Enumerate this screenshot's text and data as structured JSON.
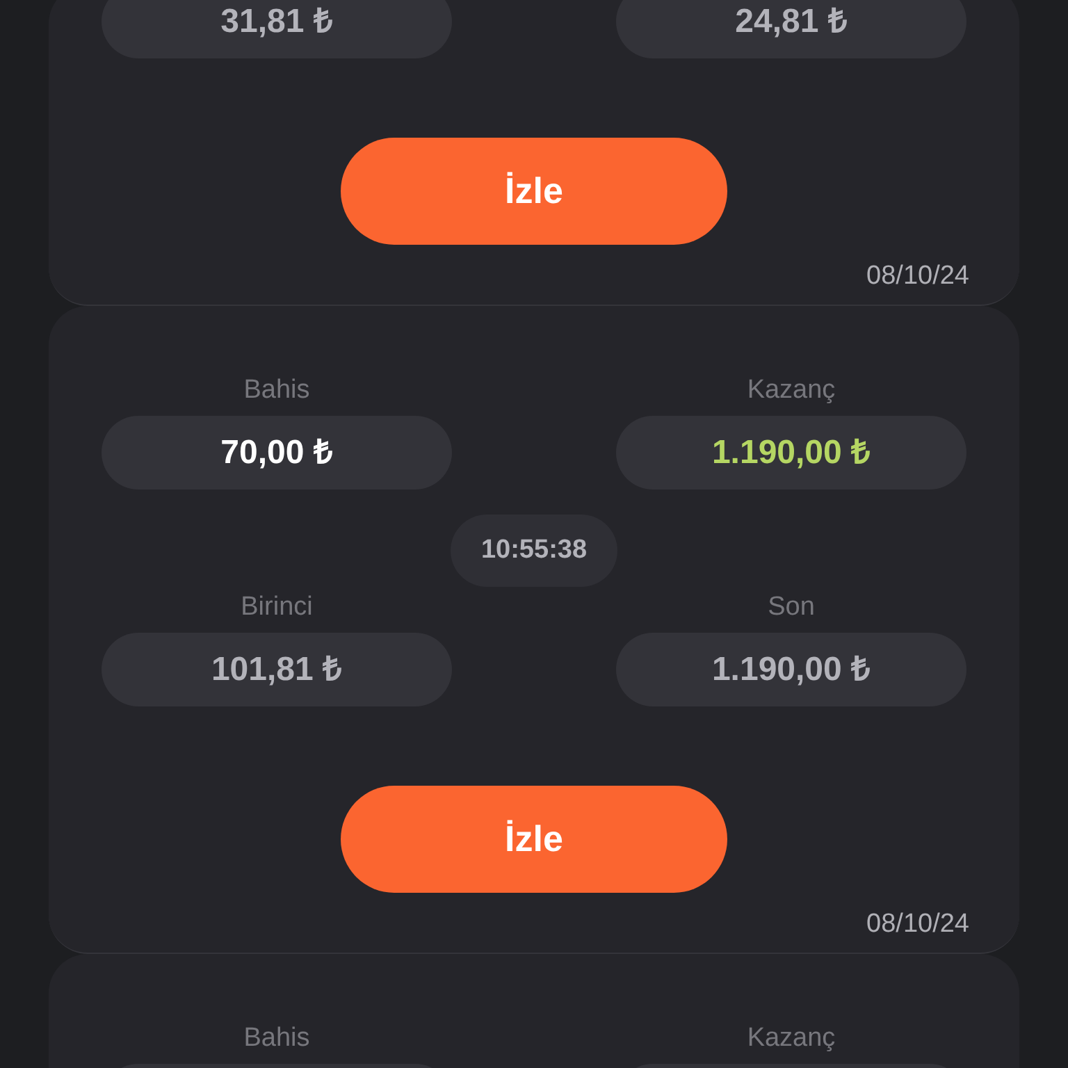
{
  "bets": [
    {
      "rows": [
        [
          {
            "value": "31,81 ₺",
            "kind": "plain"
          },
          {
            "value": "24,81 ₺",
            "kind": "plain"
          }
        ]
      ],
      "button": "İzle",
      "date": "08/10/24"
    },
    {
      "rows": [
        [
          {
            "label": "Bahis",
            "value": "70,00 ₺",
            "kind": "stake"
          },
          {
            "label": "Kazanç",
            "value": "1.190,00 ₺",
            "kind": "win"
          }
        ],
        [
          {
            "label": "Birinci",
            "value": "101,81 ₺",
            "kind": "plain"
          },
          {
            "label": "Son",
            "value": "1.190,00 ₺",
            "kind": "plain"
          }
        ]
      ],
      "time": "10:55:38",
      "button": "İzle",
      "date": "08/10/24"
    },
    {
      "rows": [
        [
          {
            "label": "Bahis",
            "kind": "plain"
          },
          {
            "label": "Kazanç",
            "kind": "plain"
          }
        ]
      ]
    }
  ]
}
